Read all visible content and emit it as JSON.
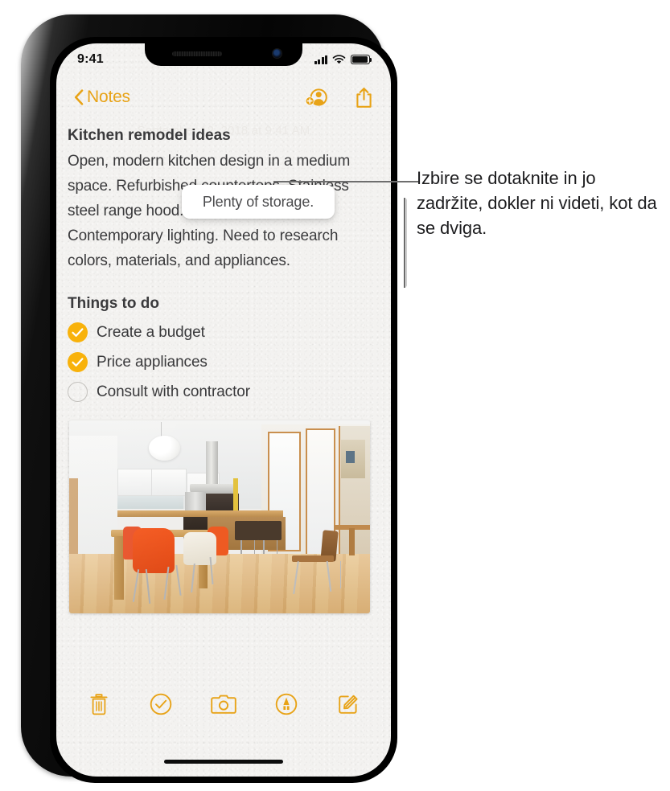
{
  "phone": {
    "status_bar": {
      "time": "9:41",
      "cellular_icon": "signal-bars-icon",
      "wifi_icon": "wifi-icon",
      "battery_icon": "battery-icon"
    },
    "nav_bar": {
      "back_label": "Notes",
      "back_icon": "chevron-left-icon",
      "add_people_icon": "add-person-icon",
      "share_icon": "share-icon"
    },
    "note": {
      "date": "September 12, 2018 at 9:41 AM",
      "title": "Kitchen remodel ideas",
      "paragraph": "Open, modern kitchen design in a medium space. Refurbished countertops. Stainless steel range hood. Plenty of storage. Contemporary lighting. Need to research colors, materials, and appliances.",
      "todo_heading": "Things to do",
      "todos": [
        {
          "label": "Create a budget",
          "checked": true
        },
        {
          "label": "Price appliances",
          "checked": true
        },
        {
          "label": "Consult with contractor",
          "checked": false
        }
      ],
      "photo_alt": "Modern open kitchen with dining table and orange chairs"
    },
    "toolbar": [
      {
        "name": "delete-button",
        "icon": "trash-icon"
      },
      {
        "name": "checklist-button",
        "icon": "checkmark-circle-icon"
      },
      {
        "name": "camera-button",
        "icon": "camera-icon"
      },
      {
        "name": "markup-button",
        "icon": "markup-pen-icon"
      },
      {
        "name": "compose-button",
        "icon": "compose-icon"
      }
    ],
    "home_indicator": "home-indicator"
  },
  "tooltip": {
    "label": "Plenty of storage."
  },
  "callout": {
    "text": "Izbire se dotaknite in jo zadržite, dokler ni videti, kot da se dviga."
  },
  "colors": {
    "accent_yellow": "#E8A317",
    "check_yellow": "#F8B20B",
    "text_primary": "#3a3a3c",
    "callout_text": "#1d1d1f",
    "paper": "#f3f2f0"
  }
}
